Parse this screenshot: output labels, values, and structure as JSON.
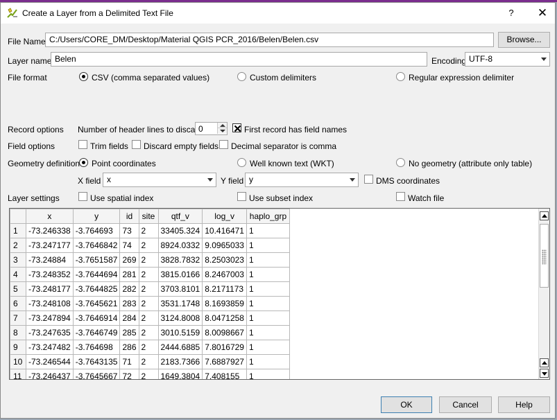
{
  "window": {
    "title": "Create a Layer from a Delimited Text File",
    "help_glyph": "?",
    "close_glyph": "✕"
  },
  "file_name": {
    "label": "File Name",
    "value": "C:/Users/CORE_DM/Desktop/Material QGIS PCR_2016/Belen/Belen.csv",
    "browse_label": "Browse..."
  },
  "layer_name": {
    "label": "Layer name",
    "value": "Belen"
  },
  "encoding": {
    "label": "Encoding",
    "value": "UTF-8"
  },
  "file_format": {
    "label": "File format",
    "options": [
      {
        "label": "CSV (comma separated values)",
        "selected": true
      },
      {
        "label": "Custom delimiters",
        "selected": false
      },
      {
        "label": "Regular expression delimiter",
        "selected": false
      }
    ]
  },
  "record_options": {
    "label": "Record options",
    "header_lines_label": "Number of header lines to discard",
    "header_lines_value": "0",
    "first_record_label": "First record has field names",
    "first_record_checked": true
  },
  "field_options": {
    "label": "Field options",
    "trim_label": "Trim fields",
    "discard_empty_label": "Discard empty fields",
    "decimal_comma_label": "Decimal separator is comma"
  },
  "geometry": {
    "label": "Geometry definition",
    "options": [
      {
        "label": "Point coordinates",
        "selected": true
      },
      {
        "label": "Well known text (WKT)",
        "selected": false
      },
      {
        "label": "No geometry (attribute only table)",
        "selected": false
      }
    ],
    "x_field_label": "X field",
    "x_field_value": "x",
    "y_field_label": "Y field",
    "y_field_value": "y",
    "dms_label": "DMS coordinates"
  },
  "layer_settings": {
    "label": "Layer settings",
    "spatial_index_label": "Use spatial index",
    "subset_index_label": "Use subset index",
    "watch_file_label": "Watch file"
  },
  "preview": {
    "columns": [
      "x",
      "y",
      "id",
      "site",
      "qtf_v",
      "log_v",
      "haplo_grp"
    ],
    "rows": [
      [
        "1",
        "-73.246338",
        "-3.764693",
        "73",
        "2",
        "33405.324",
        "10.416471",
        "1"
      ],
      [
        "2",
        "-73.247177",
        "-3.7646842",
        "74",
        "2",
        "8924.0332",
        "9.0965033",
        "1"
      ],
      [
        "3",
        "-73.24884",
        "-3.7651587",
        "269",
        "2",
        "3828.7832",
        "8.2503023",
        "1"
      ],
      [
        "4",
        "-73.248352",
        "-3.7644694",
        "281",
        "2",
        "3815.0166",
        "8.2467003",
        "1"
      ],
      [
        "5",
        "-73.248177",
        "-3.7644825",
        "282",
        "2",
        "3703.8101",
        "8.2171173",
        "1"
      ],
      [
        "6",
        "-73.248108",
        "-3.7645621",
        "283",
        "2",
        "3531.1748",
        "8.1693859",
        "1"
      ],
      [
        "7",
        "-73.247894",
        "-3.7646914",
        "284",
        "2",
        "3124.8008",
        "8.0471258",
        "1"
      ],
      [
        "8",
        "-73.247635",
        "-3.7646749",
        "285",
        "2",
        "3010.5159",
        "8.0098667",
        "1"
      ],
      [
        "9",
        "-73.247482",
        "-3.764698",
        "286",
        "2",
        "2444.6885",
        "7.8016729",
        "1"
      ],
      [
        "10",
        "-73.246544",
        "-3.7643135",
        "71",
        "2",
        "2183.7366",
        "7.6887927",
        "1"
      ],
      [
        "11",
        "-73.246437",
        "-3.7645667",
        "72",
        "2",
        "1649.3804",
        "7.408155",
        "1"
      ]
    ]
  },
  "buttons": {
    "ok": "OK",
    "cancel": "Cancel",
    "help": "Help"
  }
}
